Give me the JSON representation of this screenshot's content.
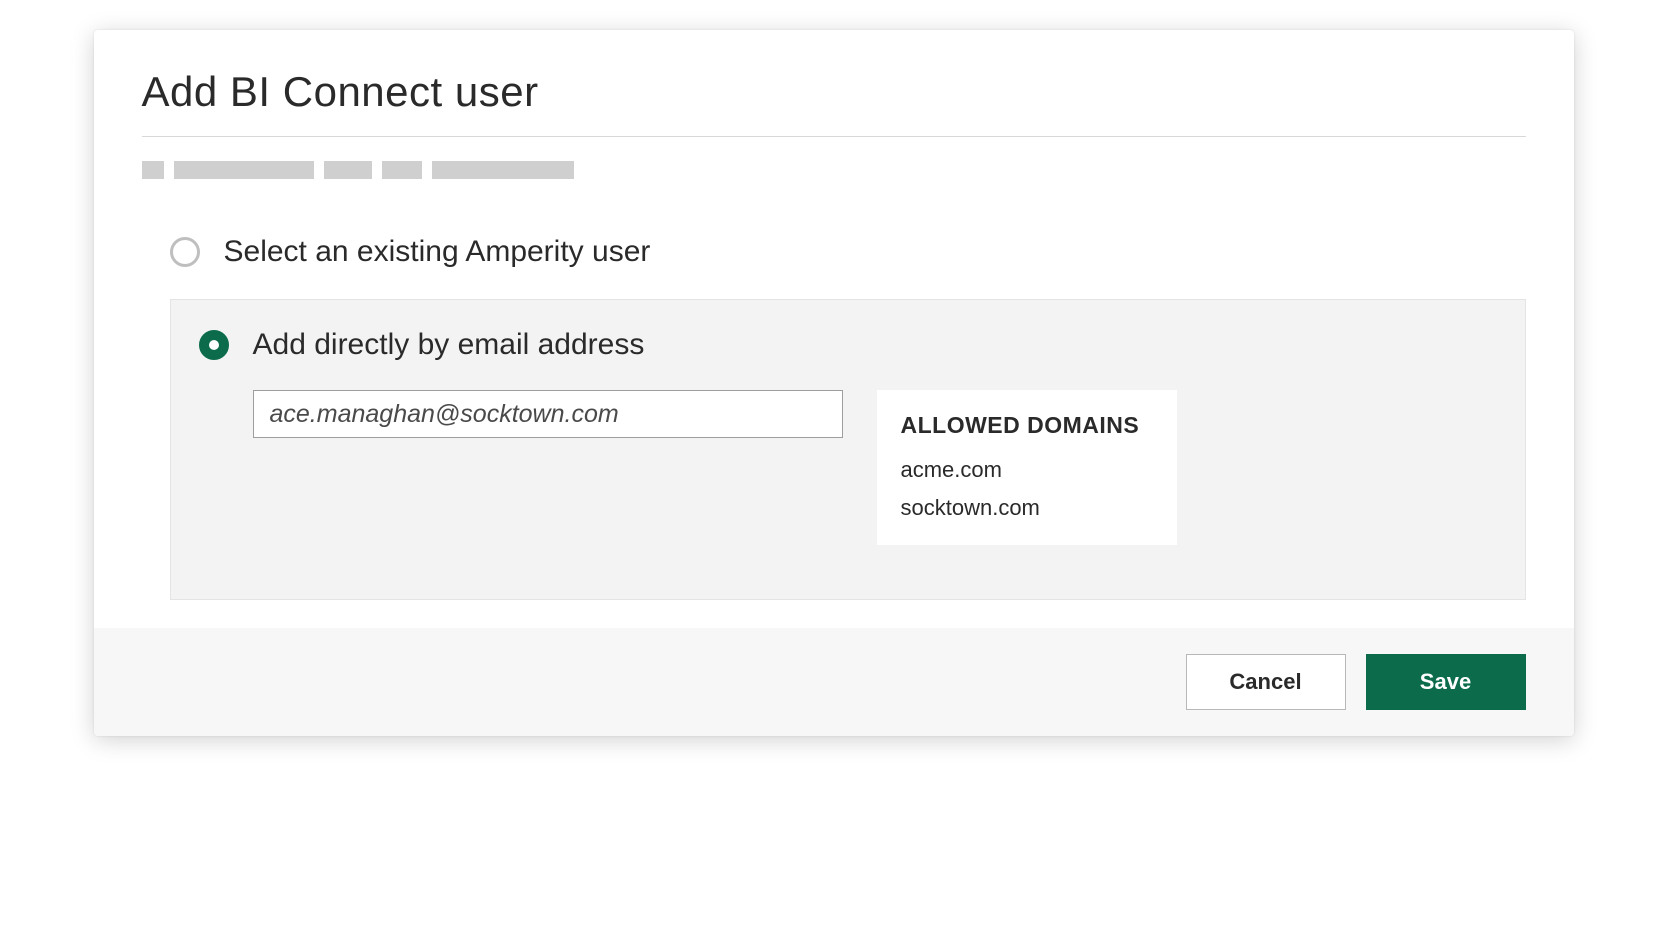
{
  "modal": {
    "title": "Add BI Connect user"
  },
  "options": {
    "existing": {
      "label": "Select an existing Amperity user",
      "selected": false
    },
    "direct": {
      "label": "Add directly by email address",
      "selected": true,
      "email_value": "ace.managhan@socktown.com"
    }
  },
  "allowed_domains": {
    "heading": "ALLOWED DOMAINS",
    "items": [
      "acme.com",
      "socktown.com"
    ]
  },
  "footer": {
    "cancel_label": "Cancel",
    "save_label": "Save"
  },
  "colors": {
    "accent": "#0b6b4a"
  }
}
